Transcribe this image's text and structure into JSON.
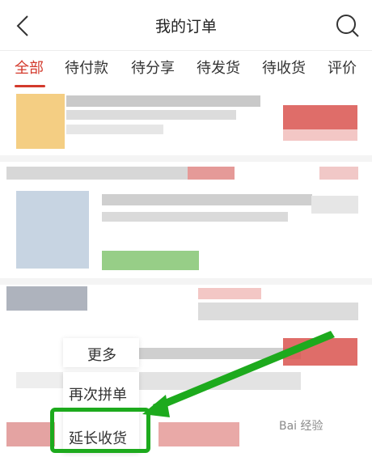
{
  "header": {
    "title": "我的订单",
    "back_icon": "chevron-left-icon",
    "search_icon": "search-icon"
  },
  "tabs": [
    {
      "label": "全部",
      "active": true
    },
    {
      "label": "待付款",
      "active": false
    },
    {
      "label": "待分享",
      "active": false
    },
    {
      "label": "待发货",
      "active": false
    },
    {
      "label": "待收货",
      "active": false
    },
    {
      "label": "评价",
      "active": false
    }
  ],
  "menu": {
    "more_label": "更多",
    "items": [
      "再次拼单",
      "延长收货"
    ]
  },
  "watermark": "Bai 经验",
  "colors": {
    "accent": "#d33a2c",
    "highlight": "#1daa1d"
  }
}
